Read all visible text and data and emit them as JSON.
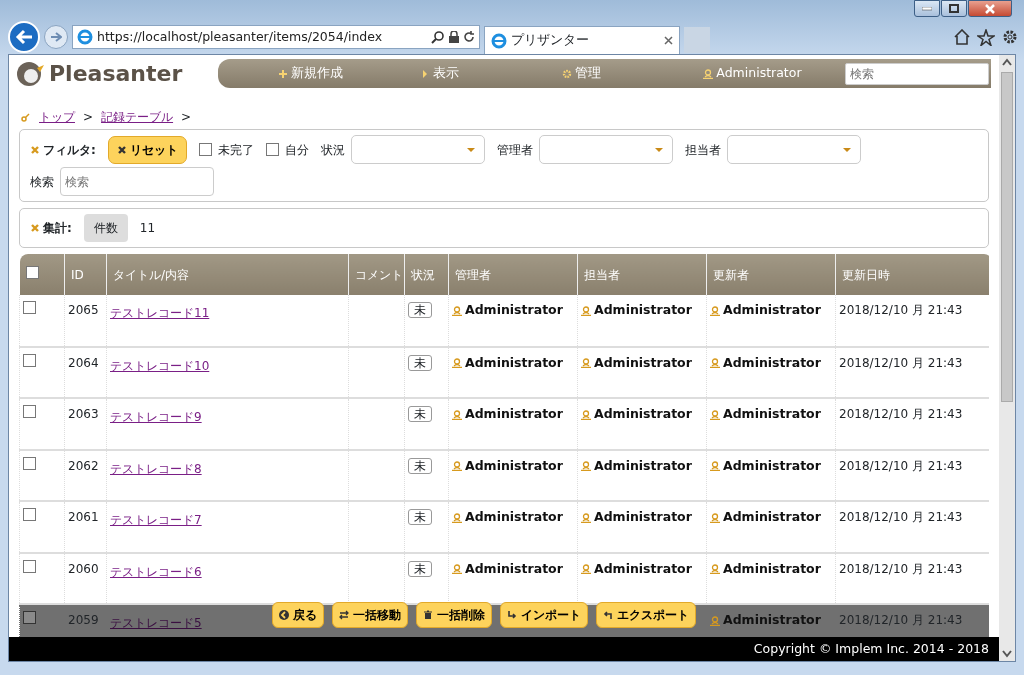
{
  "browser": {
    "url": "https://localhost/pleasanter/items/2054/index",
    "tab_title": "プリザンター"
  },
  "header": {
    "logo": "Pleasanter",
    "nav": [
      {
        "kind": "plus",
        "label": "新規作成"
      },
      {
        "kind": "arrow",
        "label": "表示"
      },
      {
        "kind": "gear",
        "label": "管理"
      },
      {
        "kind": "user",
        "label": "Administrator"
      }
    ],
    "search_placeholder": "検索"
  },
  "breadcrumb": {
    "items": [
      "トップ",
      "記録テーブル"
    ],
    "separator": ">"
  },
  "filters": {
    "title": "フィルタ:",
    "reset": "リセット",
    "checkboxes": [
      {
        "label": "未完了",
        "checked": false
      },
      {
        "label": "自分",
        "checked": false
      }
    ],
    "selects": [
      {
        "label": "状況"
      },
      {
        "label": "管理者"
      },
      {
        "label": "担当者"
      }
    ],
    "search": {
      "label": "検索",
      "placeholder": "検索"
    }
  },
  "aggregation": {
    "title": "集計:",
    "type": "件数",
    "count": "11"
  },
  "table": {
    "all_selected": false,
    "columns": [
      "ID",
      "タイトル/内容",
      "コメント",
      "状況",
      "管理者",
      "担当者",
      "更新者",
      "更新日時"
    ],
    "rows": [
      {
        "selected": false,
        "id": "2065",
        "title": "テストレコード11",
        "status": "未",
        "manager": "Administrator",
        "assignee": "Administrator",
        "updater": "Administrator",
        "updated": "2018/12/10 月 21:43"
      },
      {
        "selected": false,
        "id": "2064",
        "title": "テストレコード10",
        "status": "未",
        "manager": "Administrator",
        "assignee": "Administrator",
        "updater": "Administrator",
        "updated": "2018/12/10 月 21:43"
      },
      {
        "selected": false,
        "id": "2063",
        "title": "テストレコード9",
        "status": "未",
        "manager": "Administrator",
        "assignee": "Administrator",
        "updater": "Administrator",
        "updated": "2018/12/10 月 21:43"
      },
      {
        "selected": false,
        "id": "2062",
        "title": "テストレコード8",
        "status": "未",
        "manager": "Administrator",
        "assignee": "Administrator",
        "updater": "Administrator",
        "updated": "2018/12/10 月 21:43"
      },
      {
        "selected": false,
        "id": "2061",
        "title": "テストレコード7",
        "status": "未",
        "manager": "Administrator",
        "assignee": "Administrator",
        "updater": "Administrator",
        "updated": "2018/12/10 月 21:43"
      },
      {
        "selected": false,
        "id": "2060",
        "title": "テストレコード6",
        "status": "未",
        "manager": "Administrator",
        "assignee": "Administrator",
        "updater": "Administrator",
        "updated": "2018/12/10 月 21:43"
      },
      {
        "selected": false,
        "id": "2059",
        "title": "テストレコード5",
        "updater": "Administrator",
        "updated": "2018/12/10 月 21:43"
      }
    ]
  },
  "commands": [
    {
      "kind": "back",
      "label": "戻る"
    },
    {
      "kind": "move",
      "label": "一括移動"
    },
    {
      "kind": "delete",
      "label": "一括削除"
    },
    {
      "kind": "import",
      "label": "インポート"
    },
    {
      "kind": "export",
      "label": "エクスポート"
    }
  ],
  "footer": "Copyright © Implem Inc. 2014 - 2018"
}
